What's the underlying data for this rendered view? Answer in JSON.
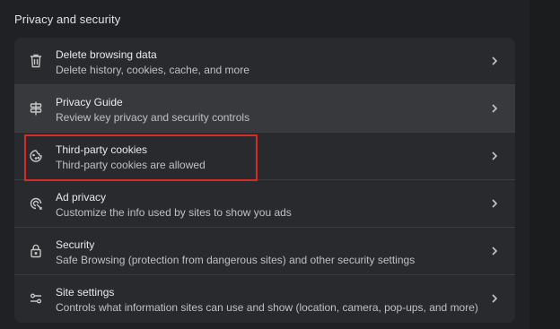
{
  "section": {
    "title": "Privacy and security"
  },
  "rows": [
    {
      "name": "delete-browsing-data",
      "icon": "trash-icon",
      "title": "Delete browsing data",
      "subtitle": "Delete history, cookies, cache, and more"
    },
    {
      "name": "privacy-guide",
      "icon": "signpost-icon",
      "title": "Privacy Guide",
      "subtitle": "Review key privacy and security controls"
    },
    {
      "name": "third-party-cookies",
      "icon": "cookie-icon",
      "title": "Third-party cookies",
      "subtitle": "Third-party cookies are allowed"
    },
    {
      "name": "ad-privacy",
      "icon": "ad-privacy-icon",
      "title": "Ad privacy",
      "subtitle": "Customize the info used by sites to show you ads"
    },
    {
      "name": "security",
      "icon": "lock-icon",
      "title": "Security",
      "subtitle": "Safe Browsing (protection from dangerous sites) and other security settings"
    },
    {
      "name": "site-settings",
      "icon": "sliders-icon",
      "title": "Site settings",
      "subtitle": "Controls what information sites can use and show (location, camera, pop-ups, and more)"
    }
  ],
  "hovered_row": "privacy-guide",
  "highlighted_row": "third-party-cookies",
  "colors": {
    "background": "#202124",
    "card": "#292a2d",
    "hover": "#38393c",
    "highlight_border": "#d42b2b",
    "text_primary": "#e8eaed",
    "text_secondary": "#bdc1c6"
  }
}
